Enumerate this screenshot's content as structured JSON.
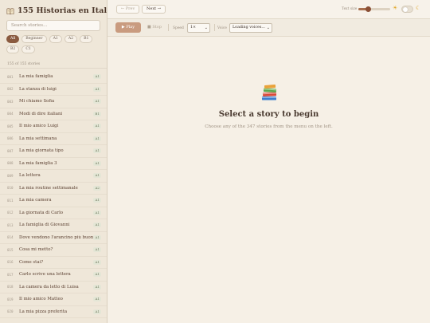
{
  "header": {
    "title": "155 Historias en Italiano"
  },
  "search": {
    "placeholder": "Search stories..."
  },
  "filters": [
    {
      "label": "All",
      "active": true
    },
    {
      "label": "Beginner",
      "active": false
    },
    {
      "label": "A1",
      "active": false
    },
    {
      "label": "A2",
      "active": false
    },
    {
      "label": "B1",
      "active": false
    },
    {
      "label": "B2",
      "active": false
    },
    {
      "label": "C1",
      "active": false
    }
  ],
  "count_text": "155 of 155 stories",
  "stories": [
    {
      "num": "001",
      "title": "La mia famiglia",
      "level": "A1"
    },
    {
      "num": "002",
      "title": "La stanza di luigi",
      "level": "A1"
    },
    {
      "num": "003",
      "title": "Mi chiamo Sofia",
      "level": "A1"
    },
    {
      "num": "004",
      "title": "Modi di dire italiani",
      "level": "B1"
    },
    {
      "num": "005",
      "title": "Il mio amico Luigi",
      "level": "A1"
    },
    {
      "num": "006",
      "title": "La mia settimana",
      "level": "A1"
    },
    {
      "num": "007",
      "title": "La mia giornata tipo",
      "level": "A1"
    },
    {
      "num": "008",
      "title": "La mia famiglia 3",
      "level": "A1"
    },
    {
      "num": "009",
      "title": "La lettera",
      "level": "A1"
    },
    {
      "num": "010",
      "title": "La mia routine settimanale",
      "level": "A2"
    },
    {
      "num": "011",
      "title": "La mia camera",
      "level": "A1"
    },
    {
      "num": "012",
      "title": "La giornata di Carlo",
      "level": "A1"
    },
    {
      "num": "013",
      "title": "La famiglia di Giovanni",
      "level": "A1"
    },
    {
      "num": "014",
      "title": "Dove vendono l'arancino più buono?",
      "level": "A1"
    },
    {
      "num": "015",
      "title": "Cosa mi metto?",
      "level": "A1"
    },
    {
      "num": "016",
      "title": "Come stai?",
      "level": "A1"
    },
    {
      "num": "017",
      "title": "Carlo scrive una lettera",
      "level": "A1"
    },
    {
      "num": "018",
      "title": "La camera da letto di Luisa",
      "level": "A1"
    },
    {
      "num": "019",
      "title": "Il mio amico Matteo",
      "level": "A1"
    },
    {
      "num": "020",
      "title": "La mia pizza preferita",
      "level": "A1"
    }
  ],
  "nav": {
    "prev": "← Prev",
    "next": "Next →"
  },
  "text_size": {
    "label": "Text size",
    "value": 0.32
  },
  "theme": {
    "light_icon": "☀",
    "dark_icon": "☾"
  },
  "toolbar": {
    "play": "▶ Play",
    "stop": "■ Stop",
    "speed_label": "Speed",
    "speed_value": "1×",
    "voice_label": "Voice",
    "voice_value": "Loading voices..."
  },
  "empty": {
    "title": "Select a story to begin",
    "subtitle": "Choose any of the 347 stories from the menu on the left."
  },
  "colors": {
    "accent": "#8a5a3f",
    "sidebar_bg": "#efe7d9",
    "main_bg": "#f6f0e6"
  }
}
